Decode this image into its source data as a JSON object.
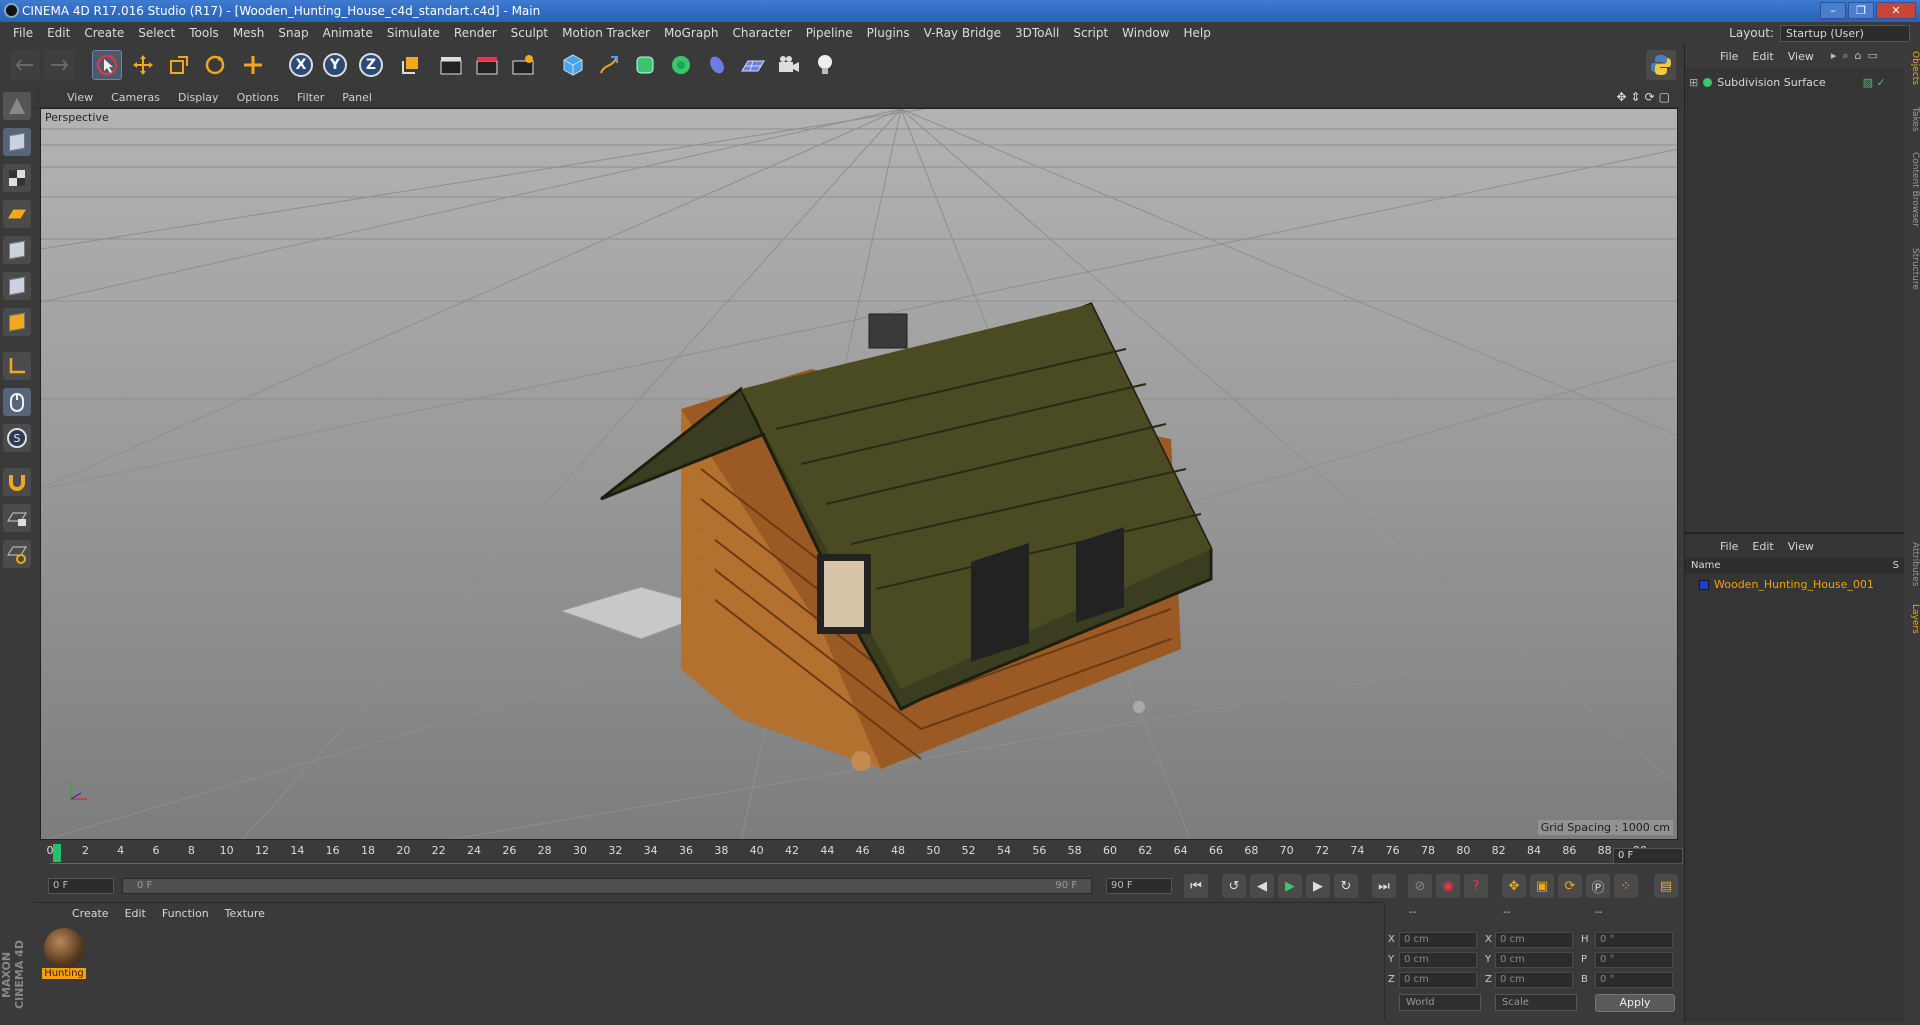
{
  "title": "CINEMA 4D R17.016 Studio (R17) - [Wooden_Hunting_House_c4d_standart.c4d] - Main",
  "window_buttons": [
    "–",
    "❐",
    "✕"
  ],
  "menu": [
    "File",
    "Edit",
    "Create",
    "Select",
    "Tools",
    "Mesh",
    "Snap",
    "Animate",
    "Simulate",
    "Render",
    "Sculpt",
    "Motion Tracker",
    "MoGraph",
    "Character",
    "Pipeline",
    "Plugins",
    "V-Ray Bridge",
    "3DToAll",
    "Script",
    "Window",
    "Help"
  ],
  "layout": {
    "label": "Layout:",
    "value": "Startup (User)"
  },
  "toolbar_axes": [
    "X",
    "Y",
    "Z"
  ],
  "viewport": {
    "menu": [
      "View",
      "Cameras",
      "Display",
      "Options",
      "Filter",
      "Panel"
    ],
    "label": "Perspective",
    "grid_spacing": "Grid Spacing : 1000 cm"
  },
  "timeline": {
    "ticks": [
      "0",
      "2",
      "4",
      "6",
      "8",
      "10",
      "12",
      "14",
      "16",
      "18",
      "20",
      "22",
      "24",
      "26",
      "28",
      "30",
      "32",
      "34",
      "36",
      "38",
      "40",
      "42",
      "44",
      "46",
      "48",
      "50",
      "52",
      "54",
      "56",
      "58",
      "60",
      "62",
      "64",
      "66",
      "68",
      "70",
      "72",
      "74",
      "76",
      "78",
      "80",
      "82",
      "84",
      "86",
      "88",
      "90"
    ],
    "current_frame": "0 F",
    "start": "0 F",
    "range_start": "0 F",
    "range_end": "90 F",
    "end": "90 F"
  },
  "materials": {
    "menu": [
      "Create",
      "Edit",
      "Function",
      "Texture"
    ],
    "items": [
      {
        "label": "Hunting"
      }
    ]
  },
  "coords": {
    "headers": [
      "--",
      "--",
      "--"
    ],
    "rows": [
      {
        "a": "X",
        "av": "0 cm",
        "b": "X",
        "bv": "0 cm",
        "c": "H",
        "cv": "0 °"
      },
      {
        "a": "Y",
        "av": "0 cm",
        "b": "Y",
        "bv": "0 cm",
        "c": "P",
        "cv": "0 °"
      },
      {
        "a": "Z",
        "av": "0 cm",
        "b": "Z",
        "bv": "0 cm",
        "c": "B",
        "cv": "0 °"
      }
    ],
    "mode1": "World",
    "mode2": "Scale",
    "apply": "Apply"
  },
  "objects": {
    "menu": [
      "File",
      "Edit",
      "View"
    ],
    "items": [
      {
        "name": "Subdivision Surface"
      }
    ]
  },
  "layers": {
    "menu": [
      "File",
      "Edit",
      "View"
    ],
    "col_name": "Name",
    "col_s": "S",
    "items": [
      {
        "name": "Wooden_Hunting_House_001",
        "color": "#1f3fd0"
      }
    ]
  },
  "side_tabs": [
    "Objects",
    "Takes",
    "Content Browser",
    "Structure",
    "Attributes",
    "Layers"
  ],
  "brand": "MAXON CINEMA 4D",
  "colors": {
    "accent": "#f2a20c",
    "playhead": "#23c26a",
    "title_bar": "#2a5fb5"
  }
}
